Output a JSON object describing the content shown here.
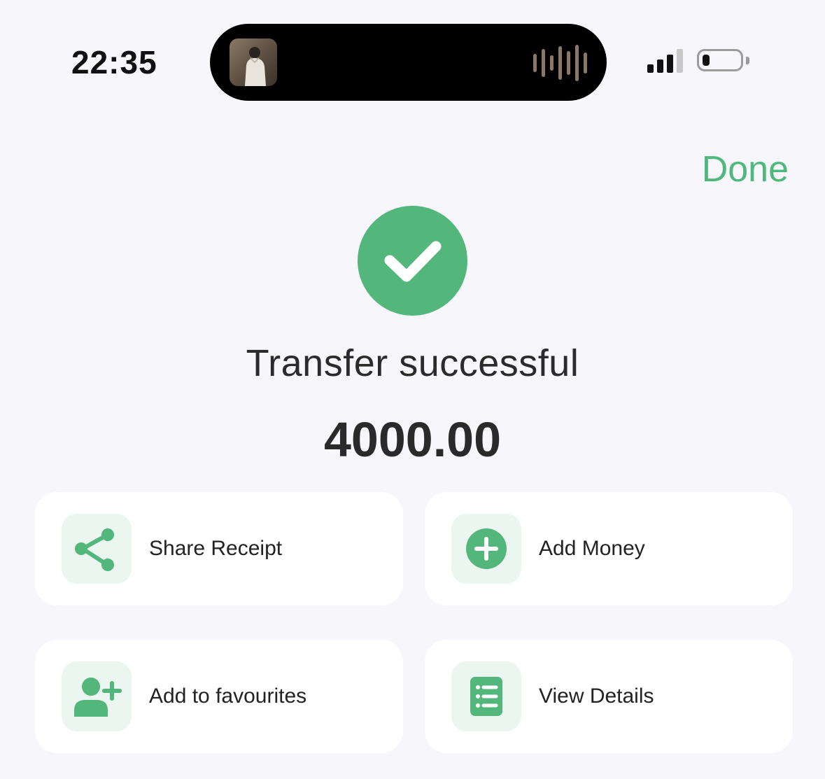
{
  "status_bar": {
    "time": "22:35"
  },
  "header": {
    "done_label": "Done"
  },
  "result": {
    "title": "Transfer successful",
    "amount": "4000.00"
  },
  "actions": [
    {
      "label": "Share Receipt",
      "icon": "share-icon"
    },
    {
      "label": "Add Money",
      "icon": "plus-circle-icon"
    },
    {
      "label": "Add to favourites",
      "icon": "add-user-icon"
    },
    {
      "label": "View Details",
      "icon": "list-icon"
    }
  ],
  "colors": {
    "accent": "#4fb87c",
    "background": "#f7f6fb",
    "card": "#ffffff",
    "icon_tile": "#eaf6ef"
  }
}
